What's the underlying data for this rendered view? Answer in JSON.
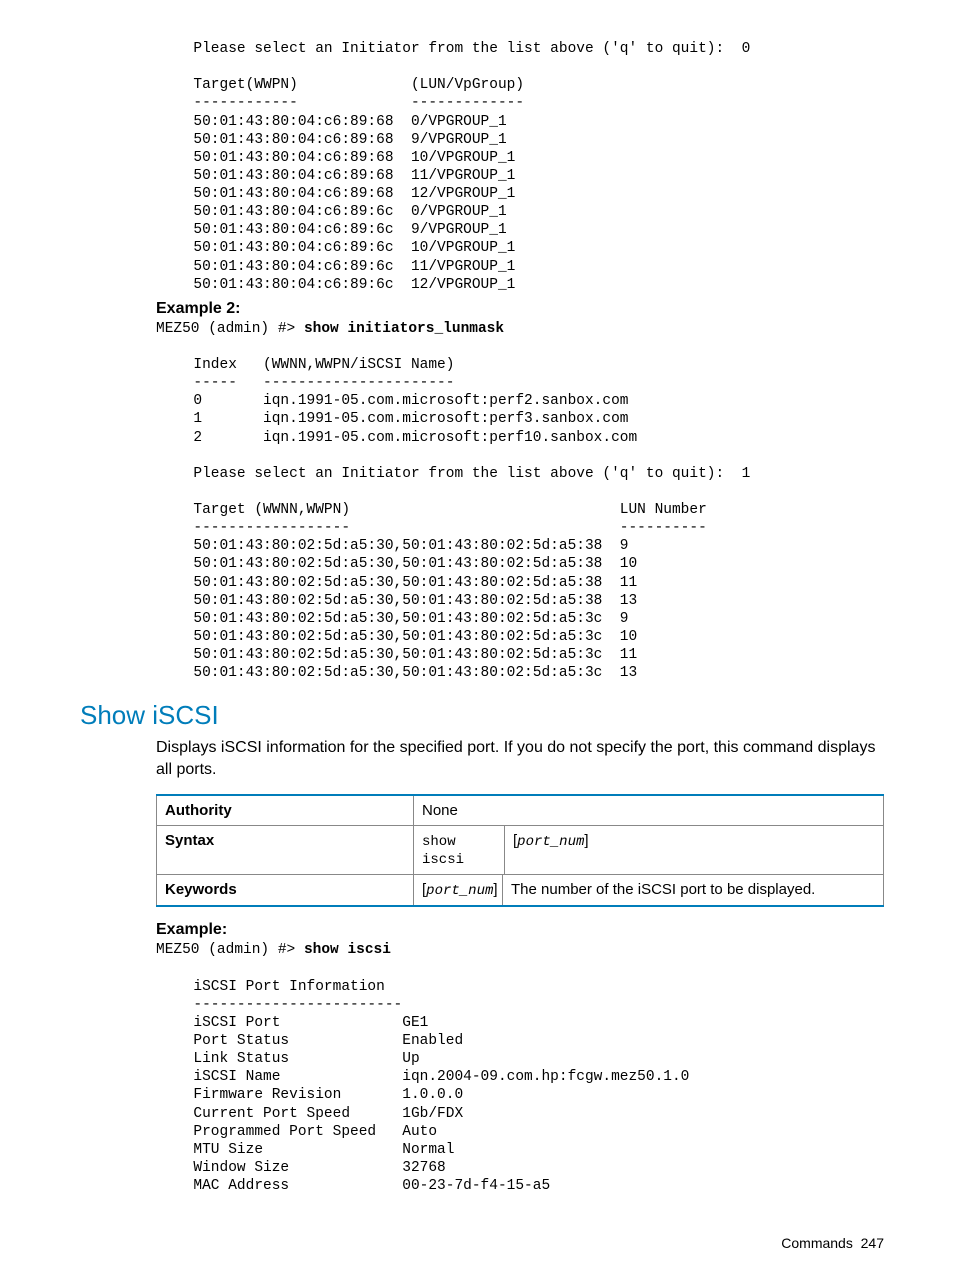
{
  "block1": "  Please select an Initiator from the list above ('q' to quit):  0\n\n  Target(WWPN)             (LUN/VpGroup)\n  ------------             -------------\n  50:01:43:80:04:c6:89:68  0/VPGROUP_1\n  50:01:43:80:04:c6:89:68  9/VPGROUP_1\n  50:01:43:80:04:c6:89:68  10/VPGROUP_1\n  50:01:43:80:04:c6:89:68  11/VPGROUP_1\n  50:01:43:80:04:c6:89:68  12/VPGROUP_1\n  50:01:43:80:04:c6:89:6c  0/VPGROUP_1\n  50:01:43:80:04:c6:89:6c  9/VPGROUP_1\n  50:01:43:80:04:c6:89:6c  10/VPGROUP_1\n  50:01:43:80:04:c6:89:6c  11/VPGROUP_1\n  50:01:43:80:04:c6:89:6c  12/VPGROUP_1",
  "example2_heading": "Example 2:",
  "example2_prompt_pre": "MEZ50 (admin) #> ",
  "example2_prompt_cmd": "show initiators_lunmask",
  "block2": "\n  Index   (WWNN,WWPN/iSCSI Name)\n  -----   ----------------------\n  0       iqn.1991-05.com.microsoft:perf2.sanbox.com\n  1       iqn.1991-05.com.microsoft:perf3.sanbox.com\n  2       iqn.1991-05.com.microsoft:perf10.sanbox.com\n\n  Please select an Initiator from the list above ('q' to quit):  1\n\n  Target (WWNN,WWPN)                               LUN Number\n  ------------------                               ----------\n  50:01:43:80:02:5d:a5:30,50:01:43:80:02:5d:a5:38  9\n  50:01:43:80:02:5d:a5:30,50:01:43:80:02:5d:a5:38  10\n  50:01:43:80:02:5d:a5:30,50:01:43:80:02:5d:a5:38  11\n  50:01:43:80:02:5d:a5:30,50:01:43:80:02:5d:a5:38  13\n  50:01:43:80:02:5d:a5:30,50:01:43:80:02:5d:a5:3c  9\n  50:01:43:80:02:5d:a5:30,50:01:43:80:02:5d:a5:3c  10\n  50:01:43:80:02:5d:a5:30,50:01:43:80:02:5d:a5:3c  11\n  50:01:43:80:02:5d:a5:30,50:01:43:80:02:5d:a5:3c  13",
  "section_title": "Show iSCSI",
  "section_desc": "Displays iSCSI information for the specified port. If you do not specify the port, this command displays all ports.",
  "table": {
    "authority_label": "Authority",
    "authority_value": "None",
    "syntax_label": "Syntax",
    "syntax_cmd": "show\niscsi",
    "syntax_arg": "port_num",
    "keywords_label": "Keywords",
    "keywords_arg": "port_num",
    "keywords_desc": "The number of the iSCSI port to be displayed."
  },
  "example3_heading": "Example:",
  "example3_prompt_pre": "MEZ50 (admin) #> ",
  "example3_prompt_cmd": "show iscsi",
  "block3": "\n  iSCSI Port Information\n  ------------------------\n  iSCSI Port              GE1\n  Port Status             Enabled\n  Link Status             Up\n  iSCSI Name              iqn.2004-09.com.hp:fcgw.mez50.1.0\n  Firmware Revision       1.0.0.0\n  Current Port Speed      1Gb/FDX\n  Programmed Port Speed   Auto\n  MTU Size                Normal\n  Window Size             32768\n  MAC Address             00-23-7d-f4-15-a5",
  "footer_label": "Commands",
  "footer_page": "247"
}
